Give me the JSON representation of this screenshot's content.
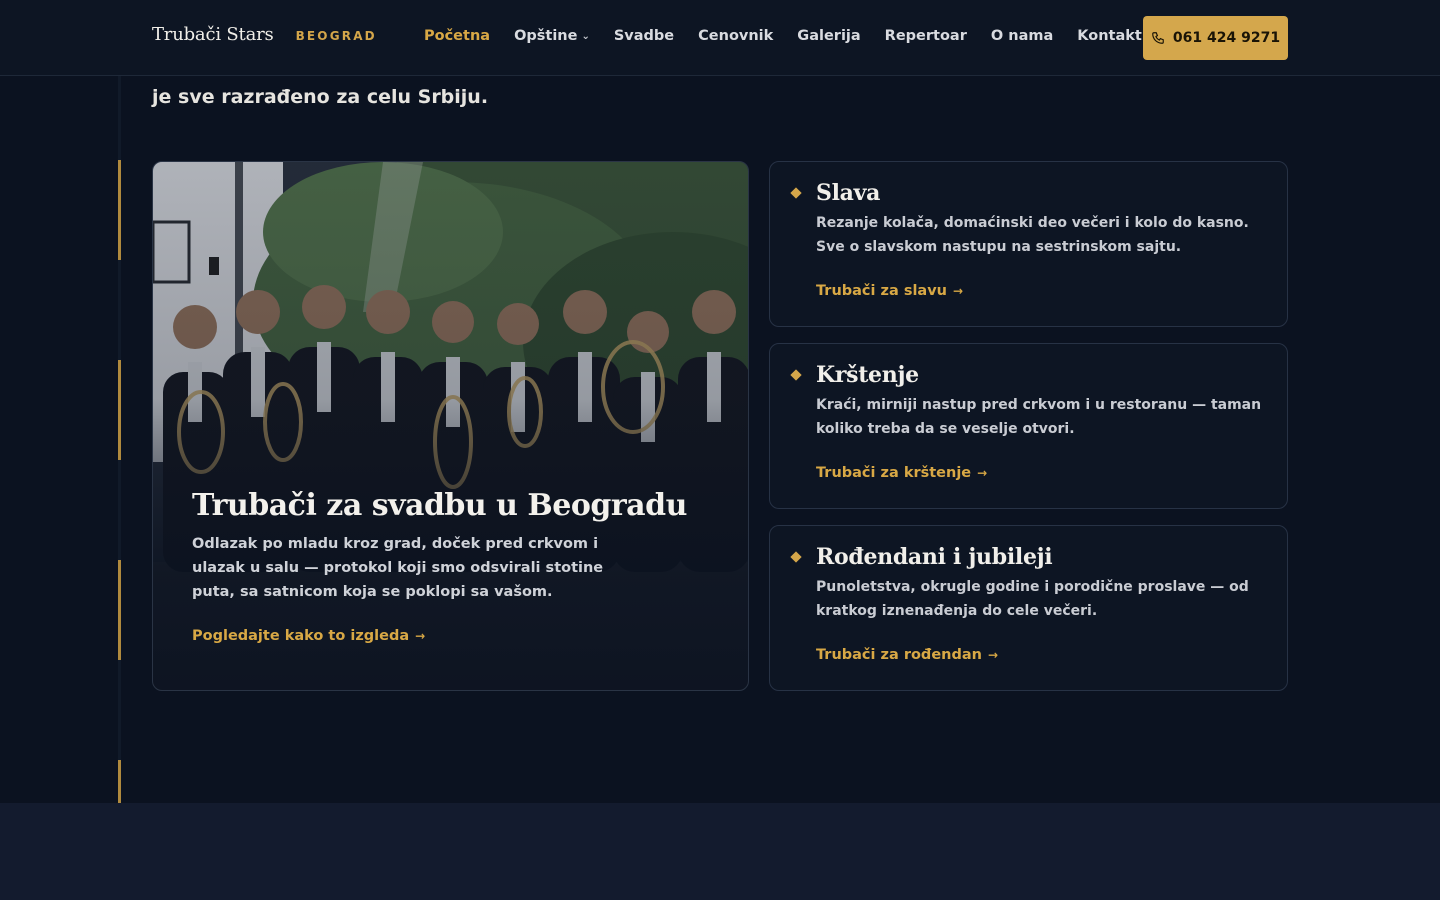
{
  "header": {
    "brand_name": "Trubači Stars",
    "brand_city": "BEOGRAD",
    "nav": [
      {
        "label": "Početna",
        "active": true
      },
      {
        "label": "Opštine",
        "dropdown": true
      },
      {
        "label": "Svadbe"
      },
      {
        "label": "Cenovnik"
      },
      {
        "label": "Galerija"
      },
      {
        "label": "Repertoar"
      },
      {
        "label": "O nama"
      },
      {
        "label": "Kontakt"
      }
    ],
    "phone": "061 424 9271",
    "phone_icon": "phone-icon"
  },
  "section": {
    "lead_tail": "je sve razrađeno za celu Srbiju."
  },
  "hero": {
    "title": "Trubači za svadbu u Beogradu",
    "text": "Odlazak po mladu kroz grad, doček pred crkvom i ulazak u salu — protokol koji smo odsvirali stotine puta, sa satnicom koja se poklopi sa vašom.",
    "link": "Pogledajte kako to izgleda",
    "arrow": "→"
  },
  "cards": [
    {
      "title": "Slava",
      "text": "Rezanje kolača, domaćinski deo večeri i kolo do kasno. Sve o slavskom nastupu na sestrinskom sajtu.",
      "link": "Trubači za slavu",
      "arrow": "→"
    },
    {
      "title": "Krštenje",
      "text": "Kraći, mirniji nastup pred crkvom i u restoranu — taman koliko treba da se veselje otvori.",
      "link": "Trubači za krštenje",
      "arrow": "→"
    },
    {
      "title": "Rođendani i jubileji",
      "text": "Punoletstva, okrugle godine i porodične proslave — od kratkog iznenađenja do cele večeri.",
      "link": "Trubači za rođendan",
      "arrow": "→"
    }
  ],
  "colors": {
    "background": "#0b1220",
    "accent": "#d4a64a",
    "card_border": "#273245"
  }
}
